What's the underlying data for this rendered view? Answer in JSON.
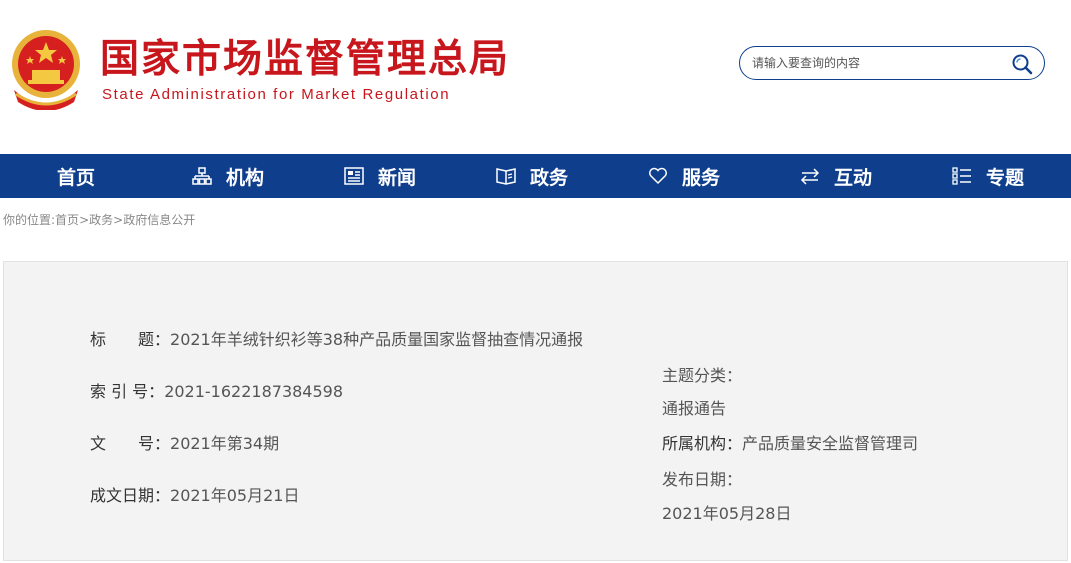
{
  "header": {
    "title_cn": "国家市场监督管理总局",
    "title_en": "State Administration for Market Regulation",
    "emblem_icon": "national-emblem-icon"
  },
  "search": {
    "placeholder": "请输入要查询的内容",
    "icon": "search-icon"
  },
  "colors": {
    "brand_red": "#c8161d",
    "nav_blue": "#0e3e8c",
    "panel_bg": "#f3f3f3"
  },
  "nav": {
    "items": [
      {
        "label": "首页",
        "icon": ""
      },
      {
        "label": "机构",
        "icon": "org-chart-icon"
      },
      {
        "label": "新闻",
        "icon": "news-icon"
      },
      {
        "label": "政务",
        "icon": "book-icon"
      },
      {
        "label": "服务",
        "icon": "heart-icon"
      },
      {
        "label": "互动",
        "icon": "exchange-arrows-icon"
      },
      {
        "label": "专题",
        "icon": "list-icon"
      }
    ]
  },
  "breadcrumb": {
    "prefix": "你的位置:",
    "items": [
      "首页",
      "政务",
      "政府信息公开"
    ],
    "separator": ">"
  },
  "info": {
    "title": {
      "label": "标　　题：",
      "value": "2021年羊绒针织衫等38种产品质量国家监督抽查情况通报"
    },
    "index_no": {
      "label": "索 引 号：",
      "value": "2021-1622187384598"
    },
    "doc_no": {
      "label": "文　　号：",
      "value": "2021年第34期"
    },
    "created_date": {
      "label": "成文日期：",
      "value": "2021年05月21日"
    },
    "topic": {
      "label": "主题分类：",
      "value": "通报通告"
    },
    "agency": {
      "label": "所属机构：",
      "value": "产品质量安全监督管理司"
    },
    "publish_date": {
      "label": "发布日期：",
      "value": "2021年05月28日"
    }
  }
}
